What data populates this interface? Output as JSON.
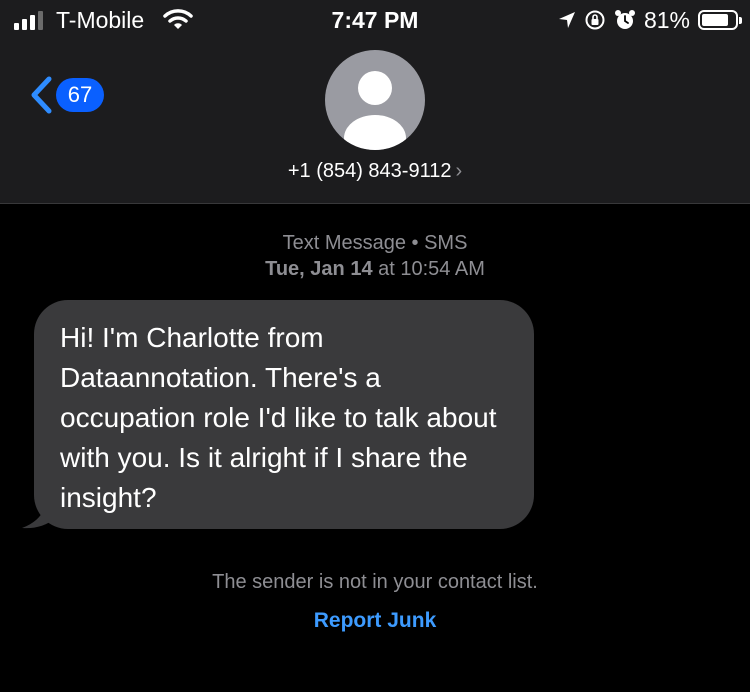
{
  "status_bar": {
    "carrier": "T-Mobile",
    "time": "7:47 PM",
    "battery_percent": "81%",
    "battery_level": 0.81,
    "signal_icon": "signal-bars-icon",
    "wifi_icon": "wifi-icon",
    "location_icon": "location-arrow-icon",
    "orientation_lock_icon": "orientation-lock-icon",
    "alarm_icon": "alarm-clock-icon"
  },
  "header": {
    "back_icon": "chevron-left-icon",
    "unread_count": "67",
    "avatar_icon": "person-silhouette-icon",
    "contact": "+1 (854) 843-9112",
    "contact_chevron": "›"
  },
  "conversation": {
    "service": "Text Message • SMS",
    "date": "Tue, Jan 14",
    "at": "at",
    "time": "10:54 AM",
    "message": "Hi! I'm Charlotte from Dataannotation. There's a occupation role I'd like to talk about with you. Is it alright if I share the insight?"
  },
  "footer": {
    "notice": "The sender is not in your contact list.",
    "report_junk": "Report Junk"
  },
  "colors": {
    "header_bg": "#1c1c1e",
    "bubble_bg": "#3a3a3c",
    "badge_blue": "#0a60ff",
    "link_blue": "#3d9bff",
    "meta_gray": "#8e8e93"
  }
}
